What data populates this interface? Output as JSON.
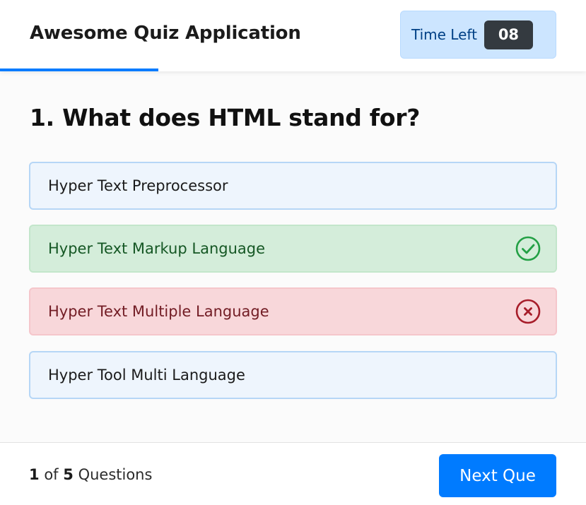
{
  "header": {
    "title": "Awesome Quiz Application",
    "timer_label": "Time Left",
    "timer_value": "08",
    "time_progress": 0.27
  },
  "question": {
    "text": "1. What does HTML stand for?",
    "options": [
      {
        "label": "Hyper Text Preprocessor",
        "state": "neutral"
      },
      {
        "label": "Hyper Text Markup Language",
        "state": "correct",
        "icon": "check-circle-icon"
      },
      {
        "label": "Hyper Text Multiple Language",
        "state": "incorrect",
        "icon": "cross-circle-icon"
      },
      {
        "label": "Hyper Tool Multi Language",
        "state": "neutral"
      }
    ]
  },
  "footer": {
    "current": "1",
    "of_text": "of",
    "total": "5",
    "questions_text": "Questions",
    "next_label": "Next Que"
  },
  "colors": {
    "accent": "#007bff",
    "correct": "#155724",
    "incorrect": "#721c24",
    "timer_bg": "#cce5ff"
  }
}
